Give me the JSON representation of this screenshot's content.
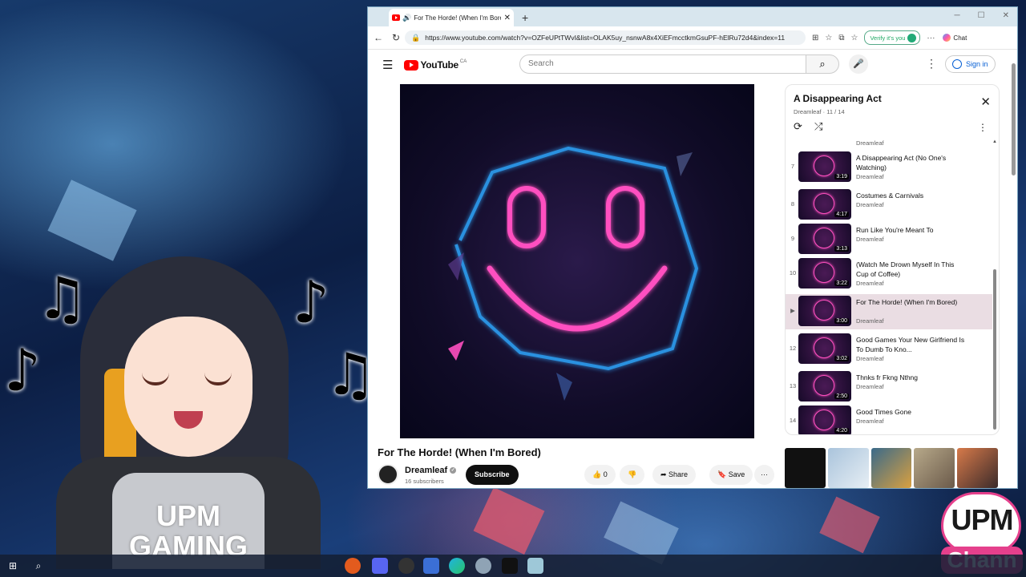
{
  "tab": {
    "title": "For The Horde! (When I'm Bored) - YouTube"
  },
  "addressbar": {
    "url": "https://www.youtube.com/watch?v=OZFeUPtTWvI&list=OLAK5uy_nsnwA8x4XiEFmcctkmGsuPF-hElRu72d4&index=11",
    "verify_label": "Verify it's you",
    "chat_label": "Chat"
  },
  "youtube": {
    "logo_text": "YouTube",
    "country": "CA",
    "search_placeholder": "Search",
    "signin_label": "Sign in"
  },
  "video": {
    "title": "For The Horde! (When I'm Bored)",
    "channel": "Dreamleaf",
    "subscribers": "16 subscribers",
    "subscribe_label": "Subscribe",
    "likes": "0",
    "share_label": "Share",
    "save_label": "Save"
  },
  "playlist": {
    "title": "A Disappearing Act",
    "subtitle": "Dreamleaf · 11 / 14",
    "prev_channel": "Dreamleaf",
    "items": [
      {
        "num": "7",
        "title": "A Disappearing Act (No One's Watching)",
        "channel": "Dreamleaf",
        "duration": "3:19"
      },
      {
        "num": "8",
        "title": "Costumes & Carnivals",
        "channel": "Dreamleaf",
        "duration": "4:17"
      },
      {
        "num": "9",
        "title": "Run Like You're Meant To",
        "channel": "Dreamleaf",
        "duration": "3:13"
      },
      {
        "num": "10",
        "title": "(Watch Me Drown Myself In This Cup of Coffee)",
        "channel": "Dreamleaf",
        "duration": "3:22"
      },
      {
        "num": "▶",
        "title": "For The Horde! (When I'm Bored)",
        "channel": "Dreamleaf",
        "duration": "3:00"
      },
      {
        "num": "12",
        "title": "Good Games Your New Girlfriend Is To Dumb To Kno...",
        "channel": "Dreamleaf",
        "duration": "3:02"
      },
      {
        "num": "13",
        "title": "Thnks fr Fkng Nthng",
        "channel": "Dreamleaf",
        "duration": "2:50"
      },
      {
        "num": "14",
        "title": "Good Times Gone",
        "channel": "Dreamleaf",
        "duration": "4:20"
      }
    ]
  },
  "overlay": {
    "shirt_text": "UPM GAMING",
    "brand_top": "UPM",
    "brand_bottom": "Chann"
  },
  "colors": {
    "brand_pink": "#e5408c",
    "youtube_red": "#ff0000",
    "neon_pink": "#ff4fc0",
    "neon_blue": "#2fa8ff"
  }
}
